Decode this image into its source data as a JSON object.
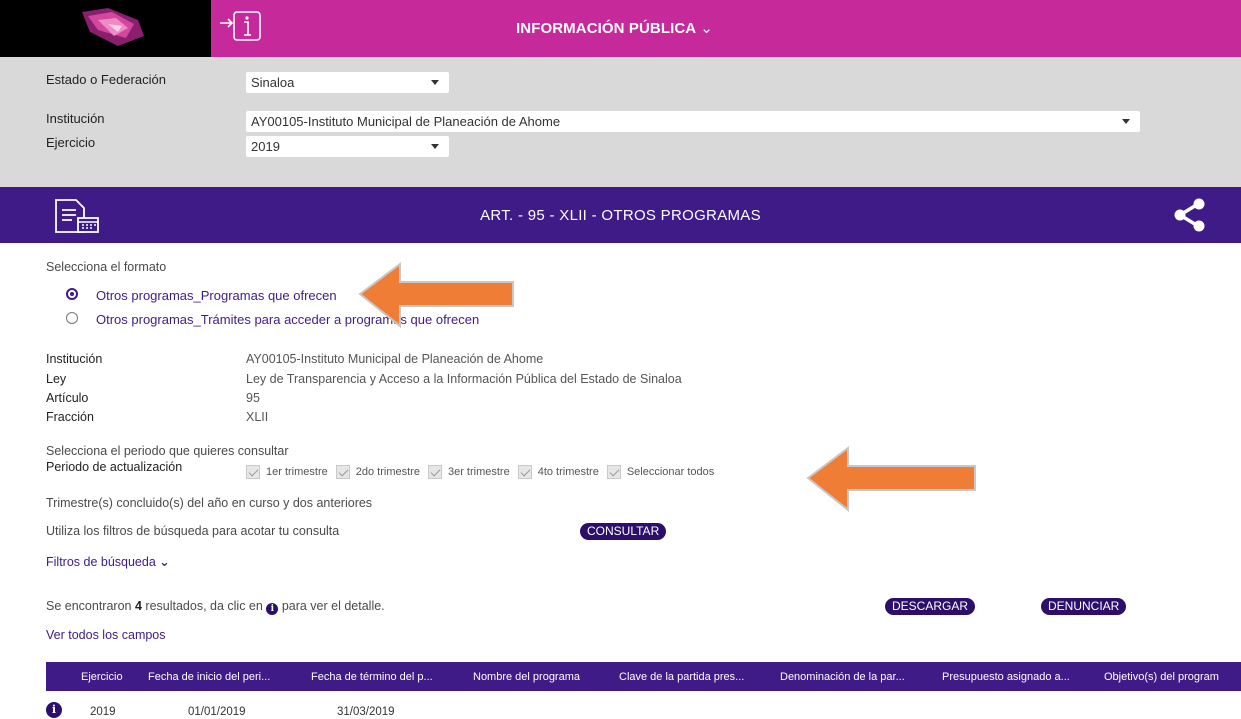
{
  "header": {
    "title": "INFORMACIÓN PÚBLICA",
    "chevron": "⌄",
    "brand_color": "#c6299a"
  },
  "filters": {
    "state_label": "Estado o Federación",
    "state_value": "Sinaloa",
    "institution_label": "Institución",
    "institution_value": "AY00105-Instituto Municipal de Planeación de Ahome",
    "year_label": "Ejercicio",
    "year_value": "2019"
  },
  "section": {
    "title": "ART. - 95 - XLII - OTROS PROGRAMAS",
    "accent_color": "#3f1b87"
  },
  "format": {
    "prompt": "Selecciona el formato",
    "options": [
      {
        "label": "Otros programas_Programas que ofrecen",
        "selected": true
      },
      {
        "label": "Otros programas_Trámites para acceder a programas que ofrecen",
        "selected": false
      }
    ]
  },
  "details": [
    {
      "label": "Institución",
      "value": "AY00105-Instituto Municipal de Planeación de Ahome"
    },
    {
      "label": "Ley",
      "value": "Ley de Transparencia y Acceso a la Información Pública del Estado de Sinaloa"
    },
    {
      "label": "Artículo",
      "value": "95"
    },
    {
      "label": "Fracción",
      "value": "XLII"
    }
  ],
  "period": {
    "prompt": "Selecciona el periodo que quieres consultar",
    "label": "Periodo de actualización",
    "options": [
      "1er trimestre",
      "2do trimestre",
      "3er trimestre",
      "4to trimestre",
      "Seleccionar todos"
    ],
    "note": "Trimestre(s) concluido(s) del año en curso y dos anteriores"
  },
  "search": {
    "hint": "Utiliza los filtros de búsqueda para acotar tu consulta",
    "consult_button": "CONSULTAR",
    "filters_toggle": "Filtros de búsqueda",
    "filters_chevron": "⌄"
  },
  "results": {
    "prefix": "Se encontraron",
    "count": "4",
    "mid": "resultados, da clic en",
    "suffix": "para ver el detalle.",
    "download_button": "DESCARGAR",
    "report_button": "DENUNCIAR",
    "view_all": "Ver todos los campos"
  },
  "table": {
    "columns": [
      "Ejercicio",
      "Fecha de inicio del peri...",
      "Fecha de término del p...",
      "Nombre del programa",
      "Clave de la partida pres...",
      "Denominación de la par...",
      "Presupuesto asignado a...",
      "Objetivo(s) del program"
    ],
    "rows": [
      {
        "ejercicio": "2019",
        "inicio": "01/01/2019",
        "termino": "31/03/2019"
      }
    ]
  },
  "icons": {
    "info": "info-icon",
    "share": "share-icon",
    "document": "document-calendar-icon",
    "arrow": "orange-arrow"
  },
  "colors": {
    "arrow_fill": "#ef7d35",
    "panel_gray": "#d9d9d9"
  }
}
